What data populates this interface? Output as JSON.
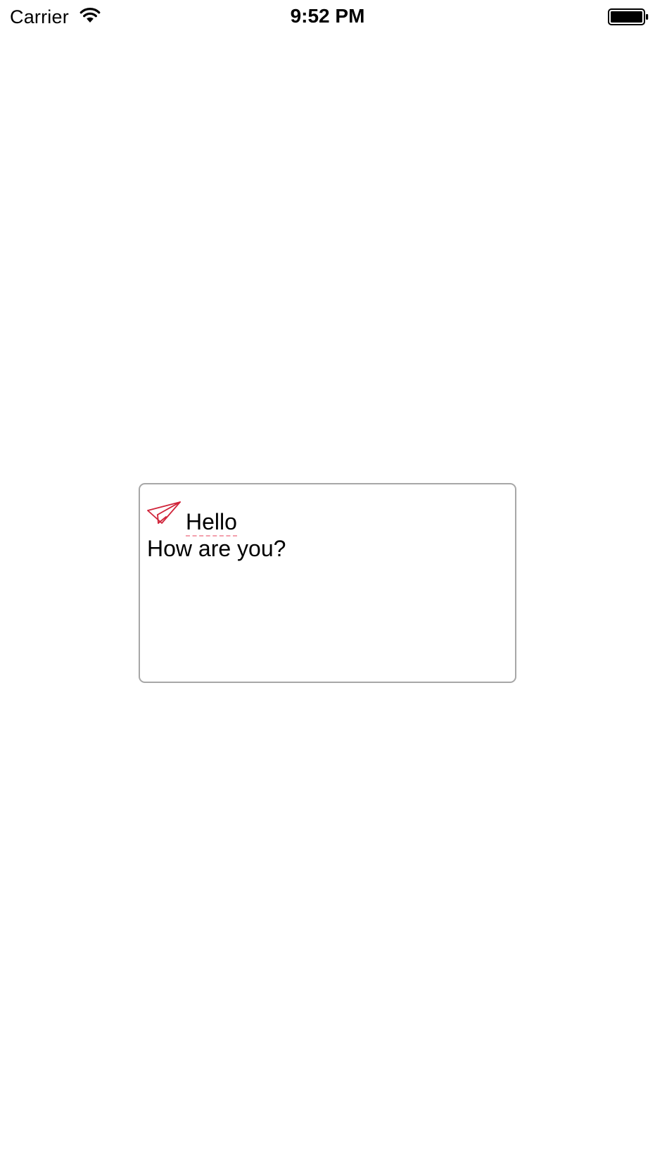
{
  "status_bar": {
    "carrier": "Carrier",
    "time": "9:52 PM",
    "wifi_icon": "wifi-icon",
    "battery_icon": "battery-icon"
  },
  "text_view": {
    "attachment_icon": "paper-plane-icon",
    "attachment_color": "#d0243a",
    "line1": "Hello",
    "line2": "How are you?",
    "border_color": "#a7a7a7",
    "spellcheck_underline_color": "#f3a0ad"
  }
}
